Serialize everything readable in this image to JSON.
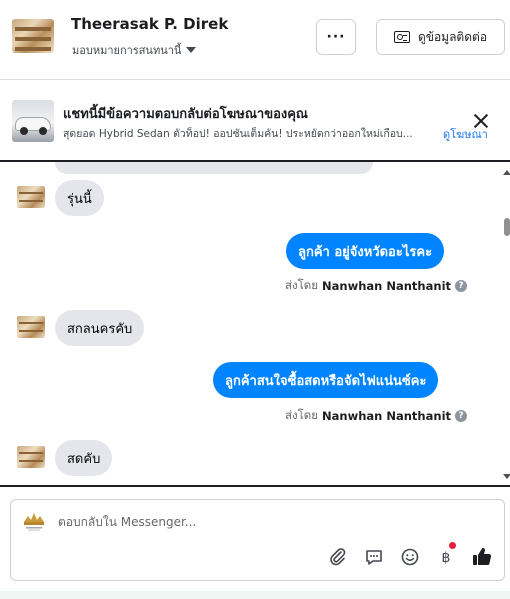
{
  "header": {
    "name": "Theerasak P. Direk",
    "assignment": "มอบหมายการสนทนานี้",
    "more_label": "···",
    "contact_label": "ดูข้อมูลติดต่อ"
  },
  "ad_banner": {
    "title": "แชทนี้มีข้อความตอบกลับต่อโฆษณาของคุณ",
    "description": "สุดยอด Hybrid Sedan ตัวท็อป! ออปชันเต็มคัน! ประหยัดกว่าออกใหม่เกือบ...",
    "link_label": "ดูโฆษณา"
  },
  "messages": [
    {
      "direction": "in",
      "text": "รุ่นนี้"
    },
    {
      "direction": "out",
      "text": "ลูกค้า   อยู่จังหวัดอะไรคะ",
      "sent_by_prefix": "ส่งโดย",
      "sent_by": "Nanwhan Nanthanit"
    },
    {
      "direction": "in",
      "text": "สกลนครคับ"
    },
    {
      "direction": "out",
      "text": "ลูกค้าสนใจซื้อสดหรือจัดไฟแน่นซ์คะ",
      "sent_by_prefix": "ส่งโดย",
      "sent_by": "Nanwhan Nanthanit"
    },
    {
      "direction": "in",
      "text": "สดคับ"
    }
  ],
  "composer": {
    "placeholder": "ตอบกลับใน Messenger...",
    "tools": [
      "attachment-icon",
      "saved-reply-icon",
      "emoji-icon",
      "payment-icon",
      "like-icon"
    ]
  },
  "colors": {
    "outgoing_bubble": "#0084ff",
    "incoming_bubble": "#e4e6eb",
    "link": "#1877f2",
    "badge": "#e41e3f"
  }
}
